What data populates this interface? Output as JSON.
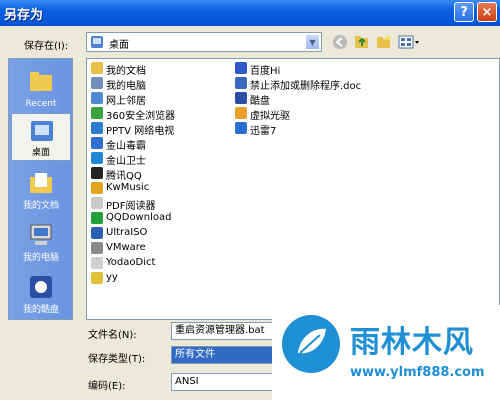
{
  "window": {
    "title": "另存为",
    "help_icon": "?",
    "close_icon": "×"
  },
  "save_in": {
    "label": "保存在(I):",
    "value": "桌面"
  },
  "places": [
    {
      "label": "Recent",
      "icon": "recent-folder-icon"
    },
    {
      "label": "桌面",
      "icon": "desktop-icon",
      "active": true
    },
    {
      "label": "我的文档",
      "icon": "my-documents-icon"
    },
    {
      "label": "我的电脑",
      "icon": "my-computer-icon"
    },
    {
      "label": "我的酷盘",
      "icon": "kupan-icon"
    }
  ],
  "files": [
    {
      "name": "我的文档",
      "color": "#e8c04a"
    },
    {
      "name": "我的电脑",
      "color": "#6f8fb8"
    },
    {
      "name": "网上邻居",
      "color": "#4f8ad0"
    },
    {
      "name": "360安全浏览器",
      "color": "#3aa33a"
    },
    {
      "name": "PPTV 网络电视",
      "color": "#2f7ccf"
    },
    {
      "name": "金山毒霸",
      "color": "#2f6fd1"
    },
    {
      "name": "金山卫士",
      "color": "#1f88d6"
    },
    {
      "name": "腾讯QQ",
      "color": "#222222"
    },
    {
      "name": "KwMusic",
      "color": "#e3a31f"
    },
    {
      "name": "PDF阅读器",
      "color": "#c9c9c9"
    },
    {
      "name": "QQDownload",
      "color": "#23a03c"
    },
    {
      "name": "UltraISO",
      "color": "#2c5fb3"
    },
    {
      "name": "VMware",
      "color": "#8a8a8a"
    },
    {
      "name": "YodaoDict",
      "color": "#cfcfcf"
    },
    {
      "name": "yy",
      "color": "#e0c23a"
    },
    {
      "name": "百度Hi",
      "color": "#2f58c8"
    },
    {
      "name": "禁止添加或删除程序.doc",
      "color": "#3a67c0"
    },
    {
      "name": "酷盘",
      "color": "#2b4fa3"
    },
    {
      "name": "虚拟光驱",
      "color": "#e6a12a"
    },
    {
      "name": "迅雷7",
      "color": "#2a6fd1"
    }
  ],
  "fields": {
    "filename_label": "文件名(N):",
    "filename_value": "重启资源管理器.bat",
    "filetype_label": "保存类型(T):",
    "filetype_value": "所有文件",
    "encoding_label": "编码(E):",
    "encoding_value": "ANSI"
  },
  "watermark": {
    "name": "雨林木风",
    "url": "www.ylmf888.com",
    "color": "#1f8fd6"
  }
}
